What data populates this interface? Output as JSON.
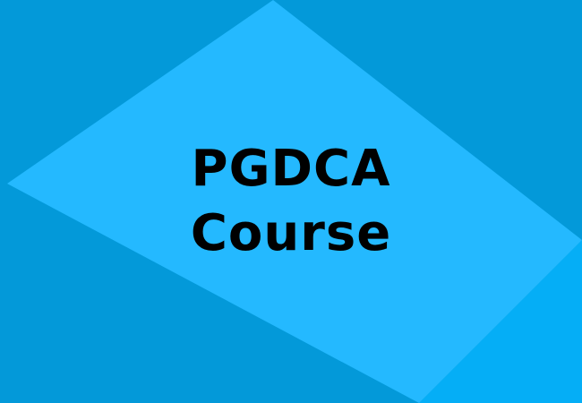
{
  "title": {
    "line1": "PGDCA",
    "line2": "Course"
  },
  "colors": {
    "background": "#0399D9",
    "diamond": "#24B9FF",
    "lower_right_triangle": "#05AEF6",
    "text": "#000000"
  }
}
